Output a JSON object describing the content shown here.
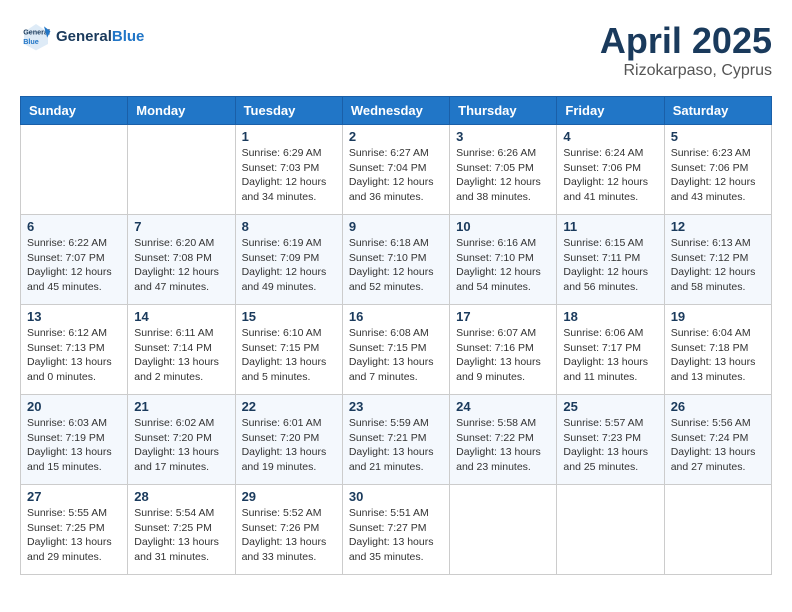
{
  "header": {
    "logo_general": "General",
    "logo_blue": "Blue",
    "month": "April 2025",
    "location": "Rizokarpaso, Cyprus"
  },
  "weekdays": [
    "Sunday",
    "Monday",
    "Tuesday",
    "Wednesday",
    "Thursday",
    "Friday",
    "Saturday"
  ],
  "weeks": [
    [
      {
        "day": "",
        "info": ""
      },
      {
        "day": "",
        "info": ""
      },
      {
        "day": "1",
        "info": "Sunrise: 6:29 AM\nSunset: 7:03 PM\nDaylight: 12 hours\nand 34 minutes."
      },
      {
        "day": "2",
        "info": "Sunrise: 6:27 AM\nSunset: 7:04 PM\nDaylight: 12 hours\nand 36 minutes."
      },
      {
        "day": "3",
        "info": "Sunrise: 6:26 AM\nSunset: 7:05 PM\nDaylight: 12 hours\nand 38 minutes."
      },
      {
        "day": "4",
        "info": "Sunrise: 6:24 AM\nSunset: 7:06 PM\nDaylight: 12 hours\nand 41 minutes."
      },
      {
        "day": "5",
        "info": "Sunrise: 6:23 AM\nSunset: 7:06 PM\nDaylight: 12 hours\nand 43 minutes."
      }
    ],
    [
      {
        "day": "6",
        "info": "Sunrise: 6:22 AM\nSunset: 7:07 PM\nDaylight: 12 hours\nand 45 minutes."
      },
      {
        "day": "7",
        "info": "Sunrise: 6:20 AM\nSunset: 7:08 PM\nDaylight: 12 hours\nand 47 minutes."
      },
      {
        "day": "8",
        "info": "Sunrise: 6:19 AM\nSunset: 7:09 PM\nDaylight: 12 hours\nand 49 minutes."
      },
      {
        "day": "9",
        "info": "Sunrise: 6:18 AM\nSunset: 7:10 PM\nDaylight: 12 hours\nand 52 minutes."
      },
      {
        "day": "10",
        "info": "Sunrise: 6:16 AM\nSunset: 7:10 PM\nDaylight: 12 hours\nand 54 minutes."
      },
      {
        "day": "11",
        "info": "Sunrise: 6:15 AM\nSunset: 7:11 PM\nDaylight: 12 hours\nand 56 minutes."
      },
      {
        "day": "12",
        "info": "Sunrise: 6:13 AM\nSunset: 7:12 PM\nDaylight: 12 hours\nand 58 minutes."
      }
    ],
    [
      {
        "day": "13",
        "info": "Sunrise: 6:12 AM\nSunset: 7:13 PM\nDaylight: 13 hours\nand 0 minutes."
      },
      {
        "day": "14",
        "info": "Sunrise: 6:11 AM\nSunset: 7:14 PM\nDaylight: 13 hours\nand 2 minutes."
      },
      {
        "day": "15",
        "info": "Sunrise: 6:10 AM\nSunset: 7:15 PM\nDaylight: 13 hours\nand 5 minutes."
      },
      {
        "day": "16",
        "info": "Sunrise: 6:08 AM\nSunset: 7:15 PM\nDaylight: 13 hours\nand 7 minutes."
      },
      {
        "day": "17",
        "info": "Sunrise: 6:07 AM\nSunset: 7:16 PM\nDaylight: 13 hours\nand 9 minutes."
      },
      {
        "day": "18",
        "info": "Sunrise: 6:06 AM\nSunset: 7:17 PM\nDaylight: 13 hours\nand 11 minutes."
      },
      {
        "day": "19",
        "info": "Sunrise: 6:04 AM\nSunset: 7:18 PM\nDaylight: 13 hours\nand 13 minutes."
      }
    ],
    [
      {
        "day": "20",
        "info": "Sunrise: 6:03 AM\nSunset: 7:19 PM\nDaylight: 13 hours\nand 15 minutes."
      },
      {
        "day": "21",
        "info": "Sunrise: 6:02 AM\nSunset: 7:20 PM\nDaylight: 13 hours\nand 17 minutes."
      },
      {
        "day": "22",
        "info": "Sunrise: 6:01 AM\nSunset: 7:20 PM\nDaylight: 13 hours\nand 19 minutes."
      },
      {
        "day": "23",
        "info": "Sunrise: 5:59 AM\nSunset: 7:21 PM\nDaylight: 13 hours\nand 21 minutes."
      },
      {
        "day": "24",
        "info": "Sunrise: 5:58 AM\nSunset: 7:22 PM\nDaylight: 13 hours\nand 23 minutes."
      },
      {
        "day": "25",
        "info": "Sunrise: 5:57 AM\nSunset: 7:23 PM\nDaylight: 13 hours\nand 25 minutes."
      },
      {
        "day": "26",
        "info": "Sunrise: 5:56 AM\nSunset: 7:24 PM\nDaylight: 13 hours\nand 27 minutes."
      }
    ],
    [
      {
        "day": "27",
        "info": "Sunrise: 5:55 AM\nSunset: 7:25 PM\nDaylight: 13 hours\nand 29 minutes."
      },
      {
        "day": "28",
        "info": "Sunrise: 5:54 AM\nSunset: 7:25 PM\nDaylight: 13 hours\nand 31 minutes."
      },
      {
        "day": "29",
        "info": "Sunrise: 5:52 AM\nSunset: 7:26 PM\nDaylight: 13 hours\nand 33 minutes."
      },
      {
        "day": "30",
        "info": "Sunrise: 5:51 AM\nSunset: 7:27 PM\nDaylight: 13 hours\nand 35 minutes."
      },
      {
        "day": "",
        "info": ""
      },
      {
        "day": "",
        "info": ""
      },
      {
        "day": "",
        "info": ""
      }
    ]
  ]
}
